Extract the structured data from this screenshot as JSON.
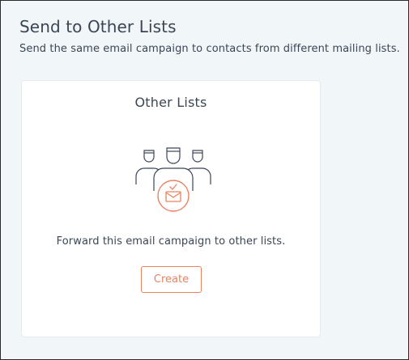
{
  "section": {
    "title": "Send to Other Lists",
    "description": "Send the same email campaign to contacts from different mailing lists."
  },
  "card": {
    "title": "Other Lists",
    "illustration_icon": "people-with-envelope-icon",
    "text": "Forward this email campaign to other lists.",
    "button_label": "Create"
  },
  "colors": {
    "accent": "#e9825f",
    "text": "#3b4654",
    "background": "#f1f6f9",
    "card": "#ffffff"
  }
}
